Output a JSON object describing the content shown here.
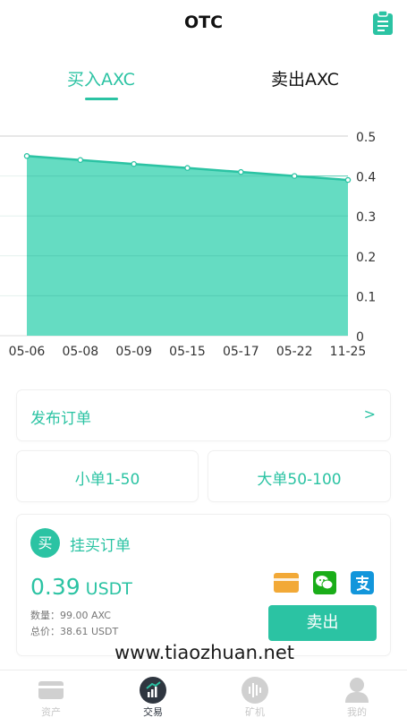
{
  "header": {
    "title": "OTC",
    "clipboard_icon": "clipboard-icon"
  },
  "tabs": [
    {
      "label": "买入AXC",
      "active": true
    },
    {
      "label": "卖出AXC",
      "active": false
    }
  ],
  "chart_data": {
    "type": "area",
    "categories": [
      "05-06",
      "05-08",
      "05-09",
      "05-15",
      "05-17",
      "05-22",
      "11-25"
    ],
    "values": [
      0.45,
      0.44,
      0.43,
      0.42,
      0.41,
      0.4,
      0.39
    ],
    "ylim": [
      0,
      0.5
    ],
    "yticks": [
      "0",
      "0.1",
      "0.2",
      "0.3",
      "0.4",
      "0.5"
    ],
    "title": "",
    "xlabel": "",
    "ylabel": "",
    "grid": true,
    "color": "#2bc3a3",
    "fill": "#65dcc2"
  },
  "publish": {
    "label": "发布订单",
    "arrow": ">"
  },
  "order_sizes": {
    "small": "小单1-50",
    "large": "大单50-100"
  },
  "buy_order": {
    "badge": "买",
    "title": "挂买订单",
    "price": "0.39",
    "unit": "USDT",
    "quantity": "数量：99.00 AXC",
    "total": "总价：38.61 USDT",
    "sell_label": "卖出",
    "payment_icons": [
      "bank-card-icon",
      "wechat-pay-icon",
      "alipay-icon"
    ]
  },
  "watermark": "www.tiaozhuan.net",
  "tabbar": [
    {
      "label": "资产",
      "icon": "wallet-icon",
      "active": false
    },
    {
      "label": "交易",
      "icon": "trade-chart-icon",
      "active": true
    },
    {
      "label": "矿机",
      "icon": "miner-icon",
      "active": false
    },
    {
      "label": "我的",
      "icon": "profile-icon",
      "active": false
    }
  ],
  "colors": {
    "accent": "#2bc3a3",
    "tab_active": "#2f3640",
    "tab_inactive": "#c8c8c8"
  }
}
